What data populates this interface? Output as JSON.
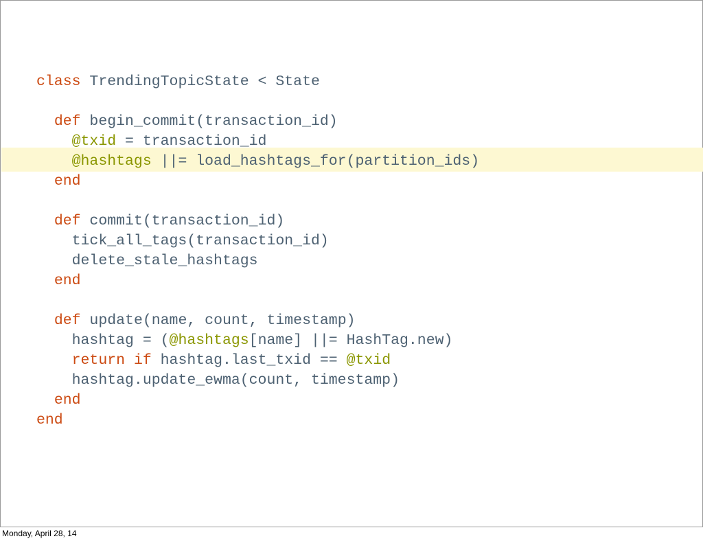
{
  "footer": {
    "date": "Monday, April 28, 14"
  },
  "colors": {
    "keyword": "#cc4a12",
    "instance_variable": "#8a9600",
    "identifier": "#4d6172",
    "highlight": "#fdf8d2"
  },
  "code": {
    "highlighted_line": 4,
    "lines": [
      [
        {
          "t": "class",
          "c": "kw"
        },
        {
          "t": " TrendingTopicState < State"
        }
      ],
      [],
      [
        {
          "t": "  "
        },
        {
          "t": "def",
          "c": "kw"
        },
        {
          "t": " begin_commit(transaction_id)"
        }
      ],
      [
        {
          "t": "    "
        },
        {
          "t": "@txid",
          "c": "ivar"
        },
        {
          "t": " = transaction_id"
        }
      ],
      [
        {
          "t": "    "
        },
        {
          "t": "@hashtags",
          "c": "ivar"
        },
        {
          "t": " ||= load_hashtags_for(partition_ids)"
        }
      ],
      [
        {
          "t": "  "
        },
        {
          "t": "end",
          "c": "kw"
        }
      ],
      [],
      [
        {
          "t": "  "
        },
        {
          "t": "def",
          "c": "kw"
        },
        {
          "t": " commit(transaction_id)"
        }
      ],
      [
        {
          "t": "    tick_all_tags(transaction_id)"
        }
      ],
      [
        {
          "t": "    delete_stale_hashtags"
        }
      ],
      [
        {
          "t": "  "
        },
        {
          "t": "end",
          "c": "kw"
        }
      ],
      [],
      [
        {
          "t": "  "
        },
        {
          "t": "def",
          "c": "kw"
        },
        {
          "t": " update(name, count, timestamp)"
        }
      ],
      [
        {
          "t": "    hashtag = ("
        },
        {
          "t": "@hashtags",
          "c": "ivar"
        },
        {
          "t": "[name] ||= HashTag.new)"
        }
      ],
      [
        {
          "t": "    "
        },
        {
          "t": "return",
          "c": "kw"
        },
        {
          "t": " "
        },
        {
          "t": "if",
          "c": "kw"
        },
        {
          "t": " hashtag.last_txid == "
        },
        {
          "t": "@txid",
          "c": "ivar"
        }
      ],
      [
        {
          "t": "    hashtag.update_ewma(count, timestamp)"
        }
      ],
      [
        {
          "t": "  "
        },
        {
          "t": "end",
          "c": "kw"
        }
      ],
      [
        {
          "t": "end",
          "c": "kw"
        }
      ]
    ]
  }
}
